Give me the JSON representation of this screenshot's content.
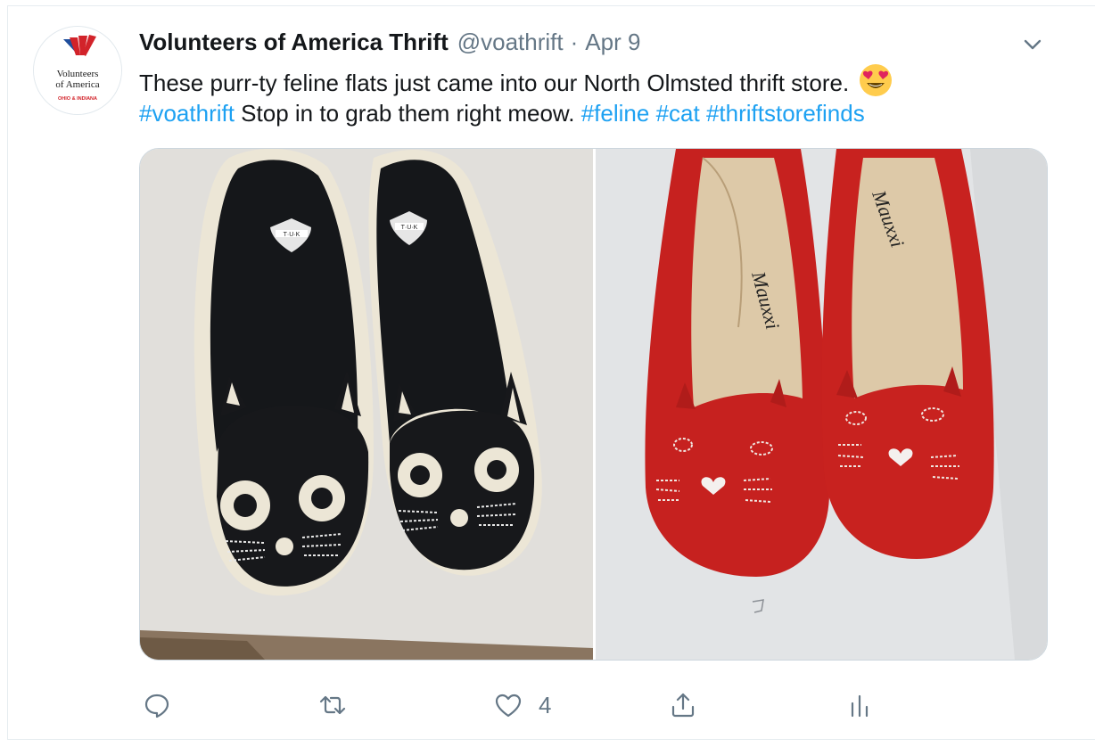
{
  "tweet": {
    "display_name": "Volunteers of America Thrift",
    "handle": "@voathrift",
    "separator": "·",
    "date": "Apr 9",
    "avatar": {
      "brand_line1": "Volunteers",
      "brand_line2": "of America",
      "region": "OHIO & INDIANA"
    },
    "text": {
      "line1": "These purr-ty feline flats just came into our North Olmsted thrift store.",
      "tag_voathrift": "#voathrift",
      "mid": " Stop in to grab them right meow. ",
      "tag_feline": "#feline",
      "tag_cat": "#cat",
      "tag_thriftstorefinds": "#thriftstorefinds",
      "emoji": "heart-eyes-emoji"
    },
    "media": {
      "left_photo": {
        "subject": "black cat-face flats",
        "insole_logo": "T·U·K"
      },
      "right_photo": {
        "subject": "red cat-face flats",
        "insole_brand": "Mauxxi"
      }
    },
    "actions": {
      "reply_icon": "reply-icon",
      "retweet_icon": "retweet-icon",
      "like_icon": "heart-icon",
      "like_count": "4",
      "share_icon": "share-icon",
      "analytics_icon": "analytics-icon"
    }
  },
  "colors": {
    "text": "#14171a",
    "secondary": "#657786",
    "link": "#1da1f2",
    "border": "#e6ecf0",
    "brand_red": "#d2232a",
    "brand_blue": "#1f4e9c"
  }
}
